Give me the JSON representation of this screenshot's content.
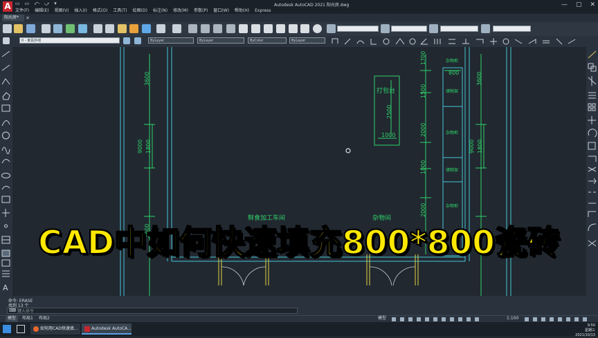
{
  "app": {
    "logo_letter": "A",
    "title": "Autodesk AutoCAD 2021    阳光房.dwg",
    "quick_access": [
      "▭",
      "▭",
      "⤺",
      "⤻",
      "▾"
    ],
    "window_controls": [
      "—",
      "▢",
      "✕"
    ]
  },
  "menu": [
    "文件(F)",
    "编辑(E)",
    "视图(V)",
    "插入(I)",
    "格式(O)",
    "工具(T)",
    "绘图(D)",
    "标注(N)",
    "修改(M)",
    "参数(P)",
    "窗口(W)",
    "帮助(H)",
    "Express"
  ],
  "doc_tab": {
    "label": "阳光房*",
    "close": "×"
  },
  "layer_toolbar": {
    "layer_combo": "0 - 家具外线",
    "color_combo": "ByLayer",
    "linetype_combo": "ByLayer",
    "lineweight_combo": "ByColor"
  },
  "drawing": {
    "texts": {
      "dabaotai": "打包台",
      "dim_2500": "2500",
      "dim_1000_a": "1000",
      "dim_3600_tl": "3600",
      "dim_9000_l": "9000",
      "dim_1800_l": "1800",
      "dim_3600_bl": "3600",
      "dim_1700": "1700",
      "dim_1500": "1500",
      "dim_2000_a": "2000",
      "dim_1000_b": "1000",
      "dim_2000_b": "2000",
      "dim_800": "800",
      "dim_3600_tr": "3600",
      "dim_9000_r": "9000",
      "dim_1800_r": "1800",
      "room_1": "鲜食加工车间",
      "room_2": "杂物间",
      "shelf_1": "杂物柜",
      "shelf_2": "储物架",
      "shelf_3": "杂物柜",
      "shelf_4": "储物架",
      "shelf_5": "杂物柜"
    }
  },
  "command": {
    "line1": "命令:  ERASE",
    "line2": "找到 13 个",
    "input_placeholder": "键入命令",
    "prompt_icon": "⌨"
  },
  "layout_tabs": [
    "模型",
    "布局1",
    "布局2"
  ],
  "status": {
    "model": "模型",
    "scale": "1:100"
  },
  "taskbar": {
    "items": [
      "如何用CAD快速填...",
      "Autodesk AutoCA..."
    ],
    "time": "9:50",
    "weekday": "星期三",
    "date": "2021/10/13"
  },
  "banner": "CAD中如何快速填充800*800瓷砖",
  "colors": {
    "accent_yellow": "#ffe800",
    "cad_green": "#2fd36a",
    "cad_cyan": "#46c6d8",
    "canvas": "#212830"
  }
}
